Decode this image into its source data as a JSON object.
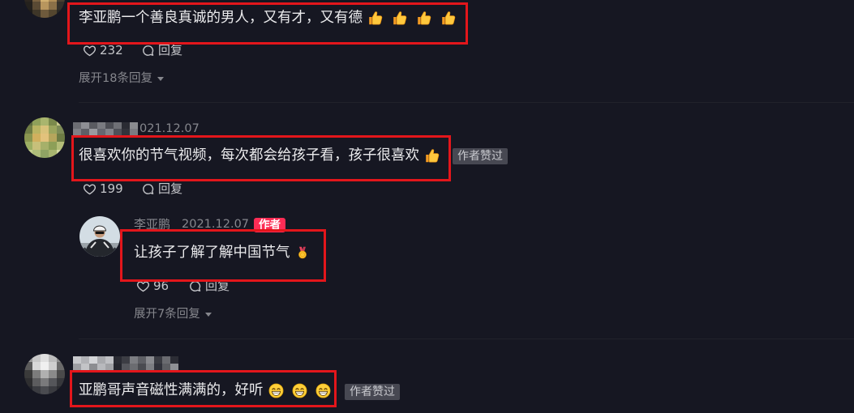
{
  "theme": {
    "background": "#161722",
    "text": "#ebebed",
    "meta": "#86878d",
    "action": "#c4c5c9",
    "highlight": "#e3161b",
    "author_badge": "#fe2c55",
    "tag_bg": "#474852",
    "tag_text": "#c9cacf"
  },
  "icons": {
    "like": "heart-outline-icon",
    "reply": "comment-bubble-icon",
    "expand": "caret-down-icon"
  },
  "comments": [
    {
      "text": "李亚鹏一个善良真诚的男人，又有才，又有德",
      "emojis": [
        "thumbs-up-emoji",
        "thumbs-up-emoji",
        "thumbs-up-emoji",
        "thumbs-up-emoji"
      ],
      "likes": "232",
      "reply_label": "回复",
      "expand_label": "展开18条回复"
    },
    {
      "date": "021.12.07",
      "text": "很喜欢你的节气视频，每次都会给孩子看，孩子很喜欢",
      "emojis": [
        "thumbs-up-emoji"
      ],
      "tag": "作者赞过",
      "likes": "199",
      "reply_label": "回复",
      "replies": [
        {
          "username": "李亚鹏",
          "date": "2021.12.07",
          "badge": "作者",
          "text": "让孩子了解了解中国节气",
          "emojis": [
            "medal-emoji"
          ],
          "likes": "96",
          "reply_label": "回复"
        }
      ],
      "expand_label": "展开7条回复"
    },
    {
      "text": "亚鹏哥声音磁性满满的，好听",
      "emojis": [
        "grin-emoji",
        "grin-emoji",
        "grin-emoji"
      ],
      "tag": "作者赞过"
    }
  ]
}
